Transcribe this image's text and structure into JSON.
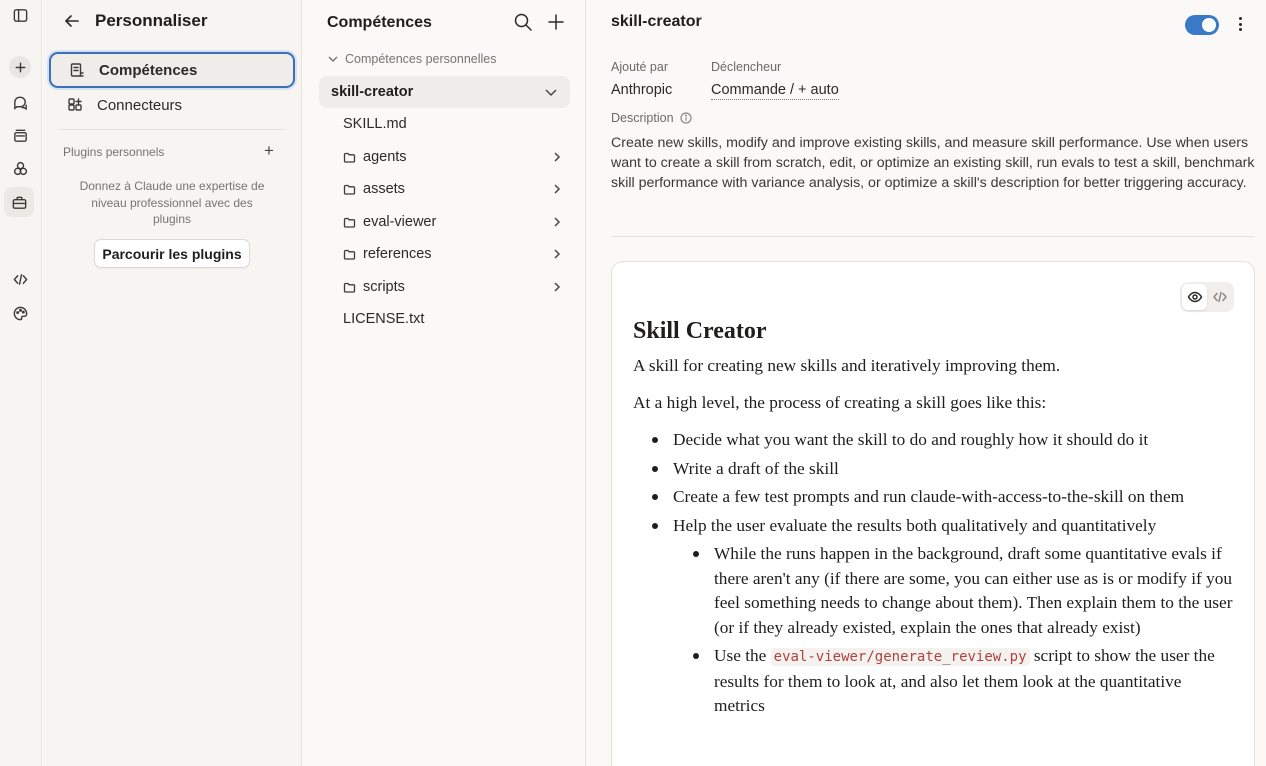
{
  "rail": {
    "icons": [
      "sidebar-toggle-icon",
      "new-chat-icon",
      "chats-icon",
      "projects-icon",
      "artifacts-icon",
      "customize-icon",
      "code-icon",
      "palette-icon"
    ]
  },
  "customize": {
    "title": "Personnaliser",
    "nav": [
      {
        "label": "Compétences",
        "active": true
      },
      {
        "label": "Connecteurs",
        "active": false
      }
    ],
    "plugins_label": "Plugins personnels",
    "plugins_add": "+",
    "plugins_desc": "Donnez à Claude une expertise de niveau professionnel avec des plugins",
    "browse_button": "Parcourir les plugins"
  },
  "skills": {
    "title": "Compétences",
    "group_label": "Compétences personnelles",
    "selected_skill": "skill-creator",
    "files": [
      {
        "name": "SKILL.md",
        "type": "file"
      },
      {
        "name": "agents",
        "type": "folder"
      },
      {
        "name": "assets",
        "type": "folder"
      },
      {
        "name": "eval-viewer",
        "type": "folder"
      },
      {
        "name": "references",
        "type": "folder"
      },
      {
        "name": "scripts",
        "type": "folder"
      },
      {
        "name": "LICENSE.txt",
        "type": "file"
      }
    ]
  },
  "detail": {
    "title": "skill-creator",
    "enabled": true,
    "added_by_label": "Ajouté par",
    "added_by_value": "Anthropic",
    "trigger_label": "Déclencheur",
    "trigger_value": "Commande / + auto",
    "description_label": "Description",
    "description": "Create new skills, modify and improve existing skills, and measure skill performance. Use when users want to create a skill from scratch, edit, or optimize an existing skill, run evals to test a skill, benchmark skill performance with variance analysis, or optimize a skill's description for better triggering accuracy.",
    "doc": {
      "heading": "Skill Creator",
      "intro": "A skill for creating new skills and iteratively improving them.",
      "lead": "At a high level, the process of creating a skill goes like this:",
      "bullets": [
        "Decide what you want the skill to do and roughly how it should do it",
        "Write a draft of the skill",
        "Create a few test prompts and run claude-with-access-to-the-skill on them",
        "Help the user evaluate the results both qualitatively and quantitatively"
      ],
      "sub_bullets": {
        "first": "While the runs happen in the background, draft some quantitative evals if there aren't any (if there are some, you can either use as is or modify if you feel something needs to change about them). Then explain them to the user (or if they already existed, explain the ones that already exist)",
        "second_pre": "Use the ",
        "second_code": "eval-viewer/generate_review.py",
        "second_post": " script to show the user the results for them to look at, and also let them look at the quantitative metrics"
      }
    }
  },
  "colors": {
    "accent": "#3a78c8",
    "code": "#b0413e"
  }
}
